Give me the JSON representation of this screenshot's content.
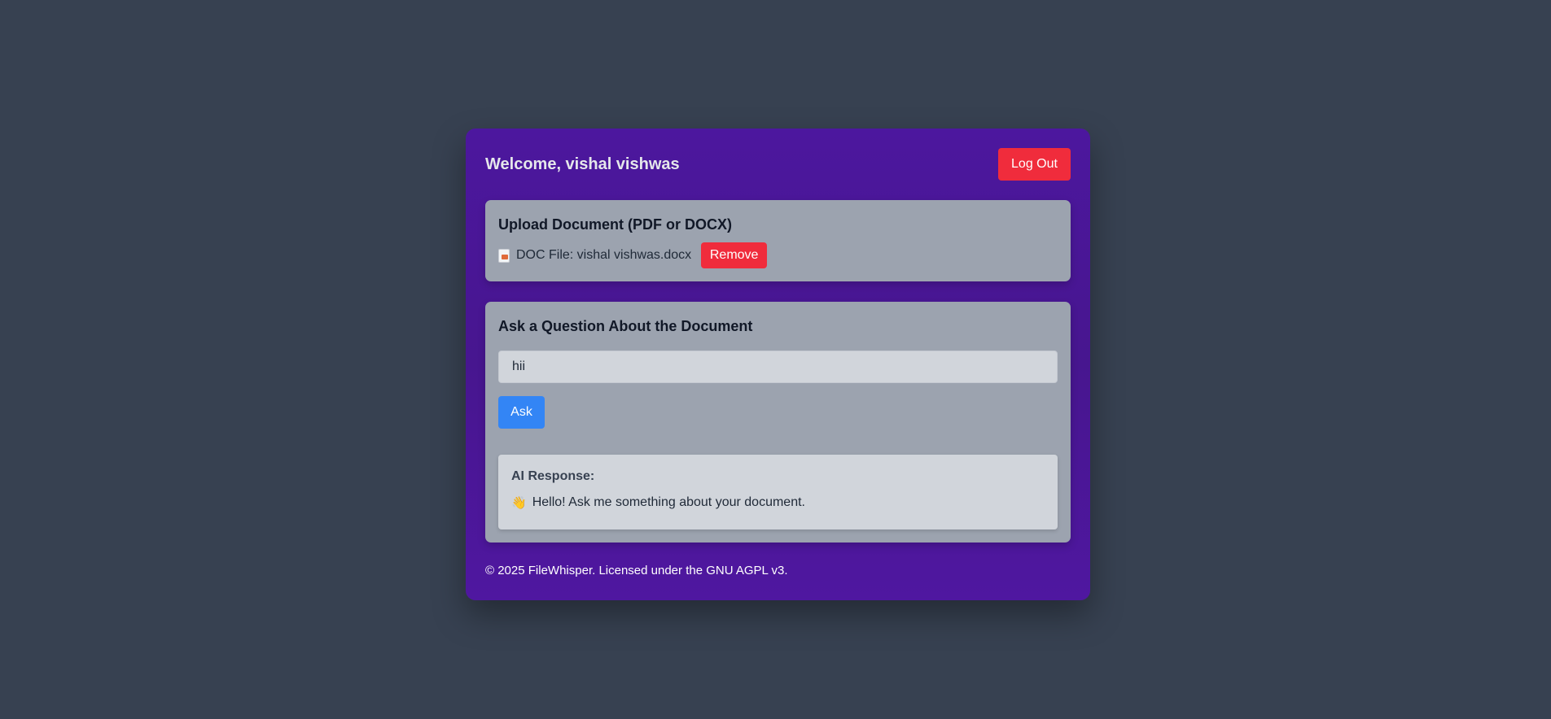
{
  "header": {
    "welcome": "Welcome, vishal vishwas",
    "logout_label": "Log Out"
  },
  "upload": {
    "title": "Upload Document (PDF or DOCX)",
    "file_icon": "document-icon",
    "file_label": "DOC File: vishal vishwas.docx",
    "remove_label": "Remove"
  },
  "question": {
    "title": "Ask a Question About the Document",
    "input_value": "hii",
    "ask_label": "Ask"
  },
  "response": {
    "label": "AI Response:",
    "icon": "👋",
    "text": "Hello! Ask me something about your document."
  },
  "footer": {
    "text": "© 2025 FileWhisper. Licensed under the GNU AGPL v3."
  },
  "colors": {
    "background": "#374151",
    "card": "#4c179e",
    "panel": "#9ca3af",
    "danger": "#f02c3c",
    "primary": "#3385f5"
  }
}
